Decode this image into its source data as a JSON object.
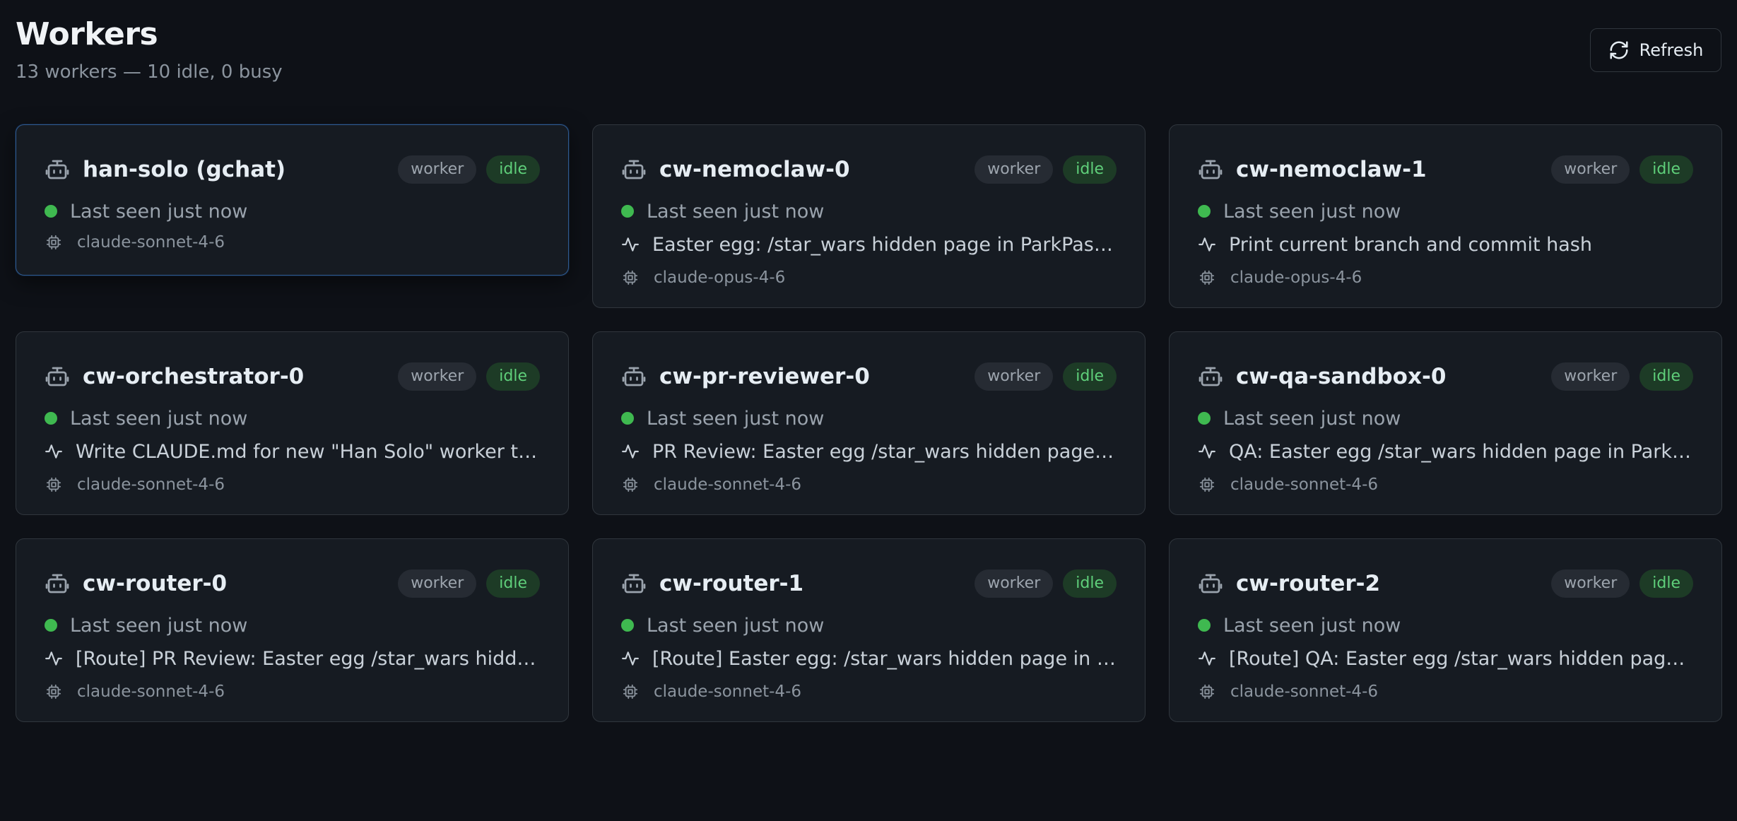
{
  "header": {
    "title": "Workers",
    "subtitle": "13 workers — 10 idle, 0 busy",
    "refresh_label": "Refresh"
  },
  "colors": {
    "background": "#0e1117",
    "card": "#161b22",
    "status_idle": "#3fb950",
    "selected_border": "#2f5a8f"
  },
  "workers": [
    {
      "name": "han-solo (gchat)",
      "role": "worker",
      "status": "idle",
      "last_seen": "Last seen just now",
      "task": "",
      "model": "claude-sonnet-4-6",
      "selected": true
    },
    {
      "name": "cw-nemoclaw-0",
      "role": "worker",
      "status": "idle",
      "last_seen": "Last seen just now",
      "task": "Easter egg: /star_wars hidden page in ParkPass a...",
      "model": "claude-opus-4-6"
    },
    {
      "name": "cw-nemoclaw-1",
      "role": "worker",
      "status": "idle",
      "last_seen": "Last seen just now",
      "task": "Print current branch and commit hash",
      "model": "claude-opus-4-6"
    },
    {
      "name": "cw-orchestrator-0",
      "role": "worker",
      "status": "idle",
      "last_seen": "Last seen just now",
      "task": "Write CLAUDE.md for new \"Han Solo\" worker type",
      "model": "claude-sonnet-4-6"
    },
    {
      "name": "cw-pr-reviewer-0",
      "role": "worker",
      "status": "idle",
      "last_seen": "Last seen just now",
      "task": "PR Review: Easter egg /star_wars hidden page in ...",
      "model": "claude-sonnet-4-6"
    },
    {
      "name": "cw-qa-sandbox-0",
      "role": "worker",
      "status": "idle",
      "last_seen": "Last seen just now",
      "task": "QA: Easter egg /star_wars hidden page in ParkPas...",
      "model": "claude-sonnet-4-6"
    },
    {
      "name": "cw-router-0",
      "role": "worker",
      "status": "idle",
      "last_seen": "Last seen just now",
      "task": "[Route] PR Review: Easter egg /star_wars hidden ...",
      "model": "claude-sonnet-4-6"
    },
    {
      "name": "cw-router-1",
      "role": "worker",
      "status": "idle",
      "last_seen": "Last seen just now",
      "task": "[Route] Easter egg: /star_wars hidden page in Par...",
      "model": "claude-sonnet-4-6"
    },
    {
      "name": "cw-router-2",
      "role": "worker",
      "status": "idle",
      "last_seen": "Last seen just now",
      "task": "[Route] QA: Easter egg /star_wars hidden page in ...",
      "model": "claude-sonnet-4-6"
    }
  ],
  "icons": {
    "card_icon": "robot-icon",
    "task_icon": "activity-icon",
    "model_icon": "cpu-icon",
    "refresh_icon": "refresh-icon"
  }
}
